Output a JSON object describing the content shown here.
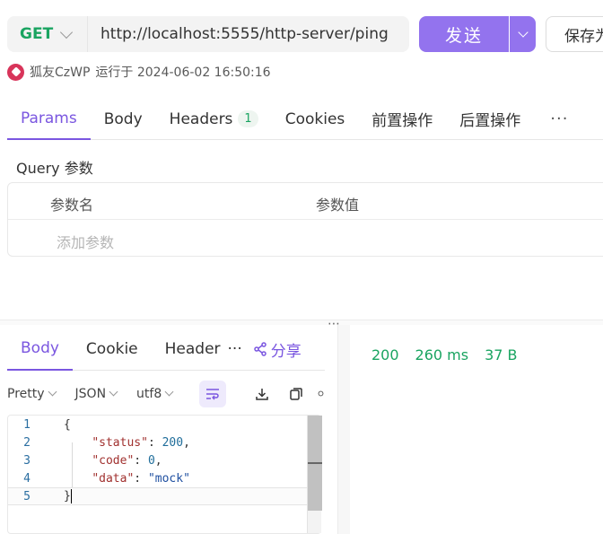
{
  "request": {
    "method": "GET",
    "url": "http://localhost:5555/http-server/ping",
    "send_label": "发送",
    "save_label": "保存为"
  },
  "meta": {
    "user": "狐友CzWP",
    "run_at_label": "运行于 2024-06-02 16:50:16"
  },
  "tabs": [
    {
      "label": "Params",
      "active": true
    },
    {
      "label": "Body"
    },
    {
      "label": "Headers",
      "badge": "1"
    },
    {
      "label": "Cookies"
    },
    {
      "label": "前置操作"
    },
    {
      "label": "后置操作"
    },
    {
      "label": "···"
    }
  ],
  "query": {
    "title": "Query 参数",
    "col_name": "参数名",
    "col_value": "参数值",
    "add_placeholder": "添加参数"
  },
  "response": {
    "tabs": [
      "Body",
      "Cookie",
      "Header"
    ],
    "more": "···",
    "share_label": "分享",
    "status_code": "200",
    "time": "260 ms",
    "size": "37 B",
    "format_options": [
      "Pretty",
      "JSON",
      "utf8"
    ],
    "code_line_numbers": [
      "1",
      "2",
      "3",
      "4",
      "5"
    ],
    "body": {
      "open": "{",
      "status_key": "\"status\"",
      "status_val": "200",
      "code_key": "\"code\"",
      "code_val": "0",
      "data_key": "\"data\"",
      "data_val": "\"mock\"",
      "close": "}"
    }
  },
  "colors": {
    "accent": "#9373ee",
    "method": "#1aa461",
    "status_ok": "#1aa461"
  }
}
